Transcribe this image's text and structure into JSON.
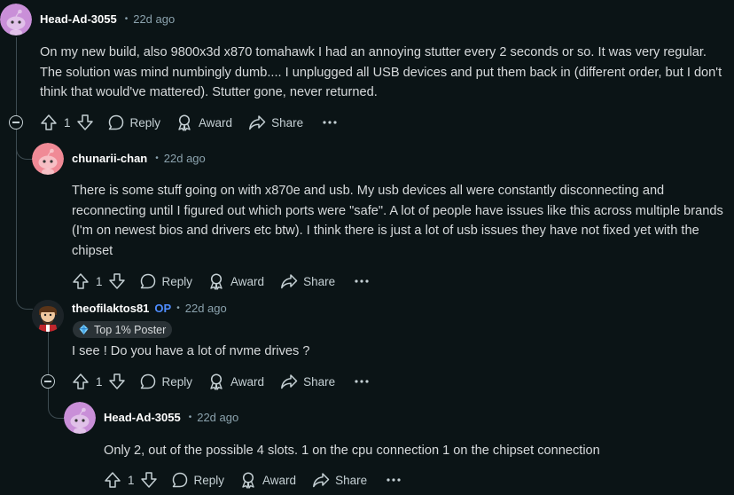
{
  "colors": {
    "background": "#0b1416",
    "op_badge": "#4f8dff",
    "thread_line": "#3e4c52"
  },
  "comments": [
    {
      "username": "Head-Ad-3055",
      "time": "22d ago",
      "body": "On my new build, also 9800x3d x870 tomahawk I had an annoying stutter every 2 seconds or so. It was very regular. The solution was mind numbingly dumb.... I unplugged all USB devices and put them back in (different order, but I don't think that would've mattered). Stutter gone, never returned.",
      "votes": "1",
      "reply_label": "Reply",
      "award_label": "Award",
      "share_label": "Share",
      "avatar_icon": "snoo-avatar-icon"
    },
    {
      "username": "chunarii-chan",
      "time": "22d ago",
      "body": "There is some stuff going on with x870e and usb. My usb devices all were constantly disconnecting and reconnecting until I figured out which ports were \"safe\". A lot of people have issues like this across multiple brands (I'm on newest bios and drivers etc btw). I think there is just a lot of usb issues they have not fixed yet with the chipset",
      "votes": "1",
      "reply_label": "Reply",
      "award_label": "Award",
      "share_label": "Share",
      "avatar_icon": "snoo-avatar-icon"
    },
    {
      "username": "theofilaktos81",
      "op_label": "OP",
      "time": "22d ago",
      "flair": "Top 1% Poster",
      "body": "I see ! Do you have a lot of nvme drives ?",
      "votes": "1",
      "reply_label": "Reply",
      "award_label": "Award",
      "share_label": "Share",
      "avatar_icon": "custom-avatar-icon"
    },
    {
      "username": "Head-Ad-3055",
      "time": "22d ago",
      "body": "Only 2, out of the possible 4 slots. 1 on the cpu connection 1 on the chipset connection",
      "votes": "1",
      "reply_label": "Reply",
      "award_label": "Award",
      "share_label": "Share",
      "avatar_icon": "snoo-avatar-icon"
    }
  ]
}
